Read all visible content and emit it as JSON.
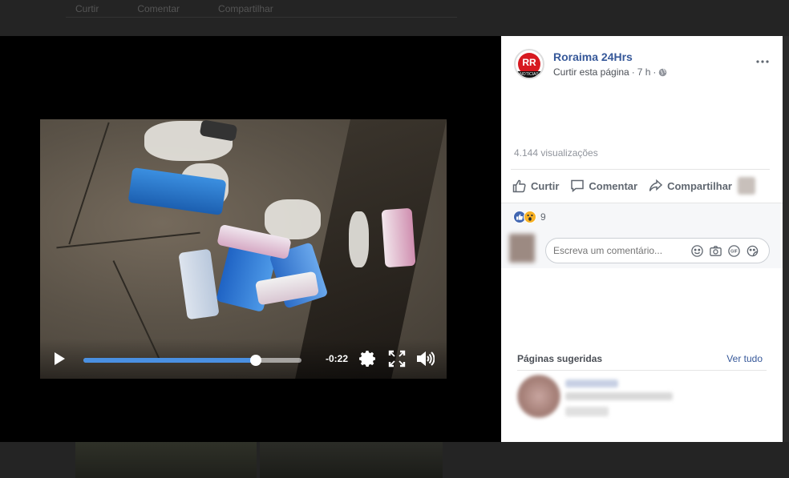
{
  "background": {
    "actions": [
      "Curtir",
      "Comentar",
      "Compartilhar"
    ]
  },
  "video": {
    "time_remaining": "-0:22",
    "progress": 0.79,
    "icons": [
      "play-icon",
      "gear-icon",
      "fullscreen-icon",
      "volume-icon"
    ]
  },
  "post": {
    "page_name": "Roraima 24Hrs",
    "logo_text": "RR",
    "logo_band": "NOTICIAS",
    "like_page": "Curtir esta página",
    "separator": "·",
    "time": "7 h",
    "separator2": "·",
    "views": "4.144 visualizações",
    "actions": {
      "like": "Curtir",
      "comment": "Comentar",
      "share": "Compartilhar"
    },
    "reaction_count": "9",
    "comment_placeholder": "Escreva um comentário...",
    "suggested_title": "Páginas sugeridas",
    "see_all": "Ver tudo"
  },
  "colors": {
    "link": "#365899",
    "seek_fill": "#4a90e2",
    "like_reaction": "#4267b2",
    "wow_reaction": "#f7b125",
    "logo_red": "#d71920"
  }
}
